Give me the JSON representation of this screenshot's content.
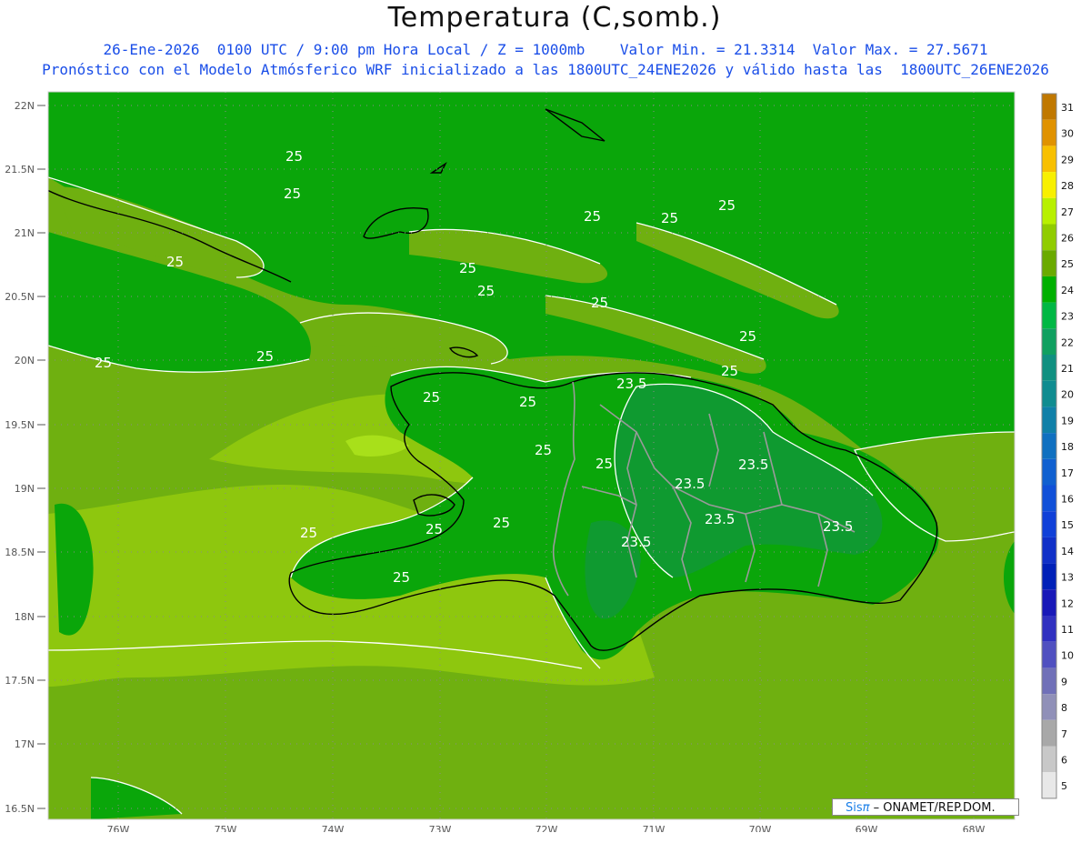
{
  "header": {
    "title": "Temperatura (C,somb.)",
    "line1": "26-Ene-2026  0100 UTC / 9:00 pm Hora Local / Z = 1000mb    Valor Min. = 21.3314  Valor Max. = 27.5671",
    "line2": "Pronóstico con el Modelo Atmósferico WRF inicializado a las 1800UTC_24ENE2026 y válido hasta las  1800UTC_26ENE2026"
  },
  "map": {
    "lat_labels": [
      "22N",
      "21.5N",
      "21N",
      "20.5N",
      "20N",
      "19.5N",
      "19N",
      "18.5N",
      "18N",
      "17.5N",
      "17N",
      "16.5N"
    ],
    "lon_labels": [
      "76W",
      "75W",
      "74W",
      "73W",
      "72W",
      "71W",
      "70W",
      "69W",
      "68W"
    ],
    "contour_labels": [
      "25",
      "25",
      "25",
      "25",
      "25",
      "25",
      "25",
      "25",
      "25",
      "25",
      "25",
      "25",
      "25",
      "25",
      "25",
      "25",
      "25",
      "25",
      "25",
      "25",
      "25",
      "23.5",
      "23.5",
      "23.5",
      "23.5",
      "23.5",
      "23.5"
    ],
    "fill_colors": {
      "c24": "#0aa60a",
      "c25": "#6fb010",
      "c26": "#8ec70e",
      "c27": "#a8e01a",
      "coast": "#000000",
      "border": "#9a9a9a",
      "contour": "#ffffff",
      "grid": "#8a8a8a"
    }
  },
  "colorbar": {
    "levels": [
      "31",
      "30",
      "29",
      "28",
      "27",
      "26",
      "25",
      "24",
      "23",
      "22",
      "21",
      "20",
      "19",
      "18",
      "17",
      "16",
      "15",
      "14",
      "13",
      "12",
      "11",
      "10",
      "9",
      "8",
      "7",
      "6",
      "5"
    ],
    "colors": [
      "#c07800",
      "#e09200",
      "#f8c000",
      "#f8f000",
      "#b8f000",
      "#90cc00",
      "#6aaa00",
      "#00b000",
      "#00b844",
      "#10a060",
      "#109080",
      "#108c90",
      "#1080a8",
      "#1070c0",
      "#1060d0",
      "#1050d8",
      "#1040d8",
      "#1030c8",
      "#0020b8",
      "#1818b8",
      "#3030c0",
      "#5050c0",
      "#7070b8",
      "#9090b8",
      "#a8a8a8",
      "#c8c8c8",
      "#e8e8e8"
    ]
  },
  "credit": {
    "sis": "Sis",
    "pi": "π",
    "rest": " – ONAMET/REP.DOM."
  }
}
